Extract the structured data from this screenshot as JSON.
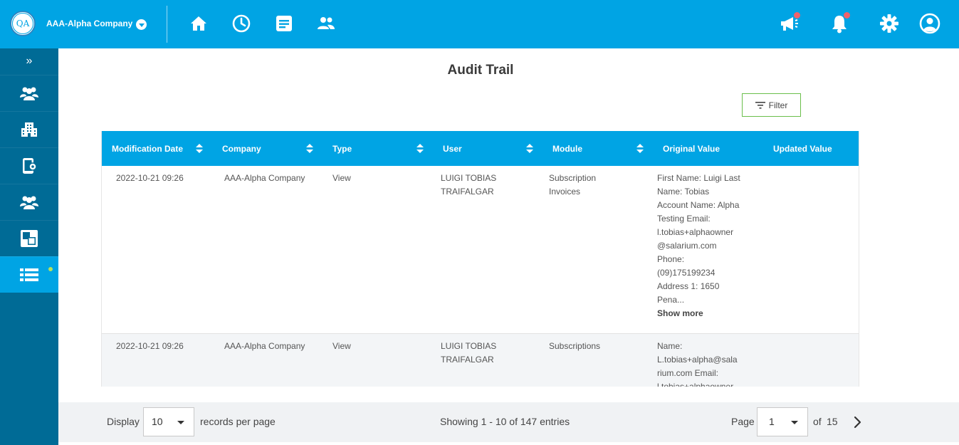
{
  "topbar": {
    "logo_text": "QA",
    "company_name": "AAA-Alpha Company",
    "icons": [
      "home-icon",
      "clock-icon",
      "document-icon",
      "people-icon",
      "megaphone-icon",
      "bell-icon",
      "gear-icon",
      "account-icon"
    ],
    "badge_color": "#f0626b",
    "bar_color": "#00a4e4"
  },
  "sidebar": {
    "expand_glyph": "»",
    "items": [
      {
        "icon": "group-icon"
      },
      {
        "icon": "building-icon"
      },
      {
        "icon": "mobile-settings-icon"
      },
      {
        "icon": "team-icon"
      },
      {
        "icon": "squares-icon"
      },
      {
        "icon": "list-icon",
        "active": true
      }
    ],
    "bg_color": "#006b96",
    "active_color": "#00a4e4"
  },
  "page": {
    "title": "Audit Trail",
    "filter_label": "Filter"
  },
  "table": {
    "columns": [
      "Modification Date",
      "Company",
      "Type",
      "User",
      "Module",
      "Original Value",
      "Updated Value"
    ],
    "rows": [
      {
        "date": "2022-10-21 09:26",
        "company": "AAA-Alpha Company",
        "type": "View",
        "user": [
          "LUIGI TOBIAS",
          "TRAIFALGAR"
        ],
        "module": [
          "Subscription",
          "Invoices"
        ],
        "original": [
          "First Name: Luigi Last",
          "Name: Tobias",
          "Account Name: Alpha",
          "Testing Email:",
          "l.tobias+alphaowner",
          "@salarium.com",
          "Phone:",
          "(09)175199234",
          "Address 1: 1650",
          "Pena..."
        ],
        "show_more": "Show more",
        "updated": ""
      },
      {
        "date": "2022-10-21 09:26",
        "company": "AAA-Alpha Company",
        "type": "View",
        "user": [
          "LUIGI TOBIAS",
          "TRAIFALGAR"
        ],
        "module": [
          "Subscriptions"
        ],
        "original": [
          "Name:",
          "L.tobias+alpha@sala",
          "rium.com Email:",
          "l.tobias+alphaowner"
        ],
        "updated": ""
      }
    ]
  },
  "footer": {
    "display_label": "Display",
    "per_page_value": "10",
    "records_label": "records per page",
    "showing_text": "Showing 1 - 10 of 147 entries",
    "page_label": "Page",
    "page_value": "1",
    "of_label": "of",
    "total_pages": "15"
  }
}
